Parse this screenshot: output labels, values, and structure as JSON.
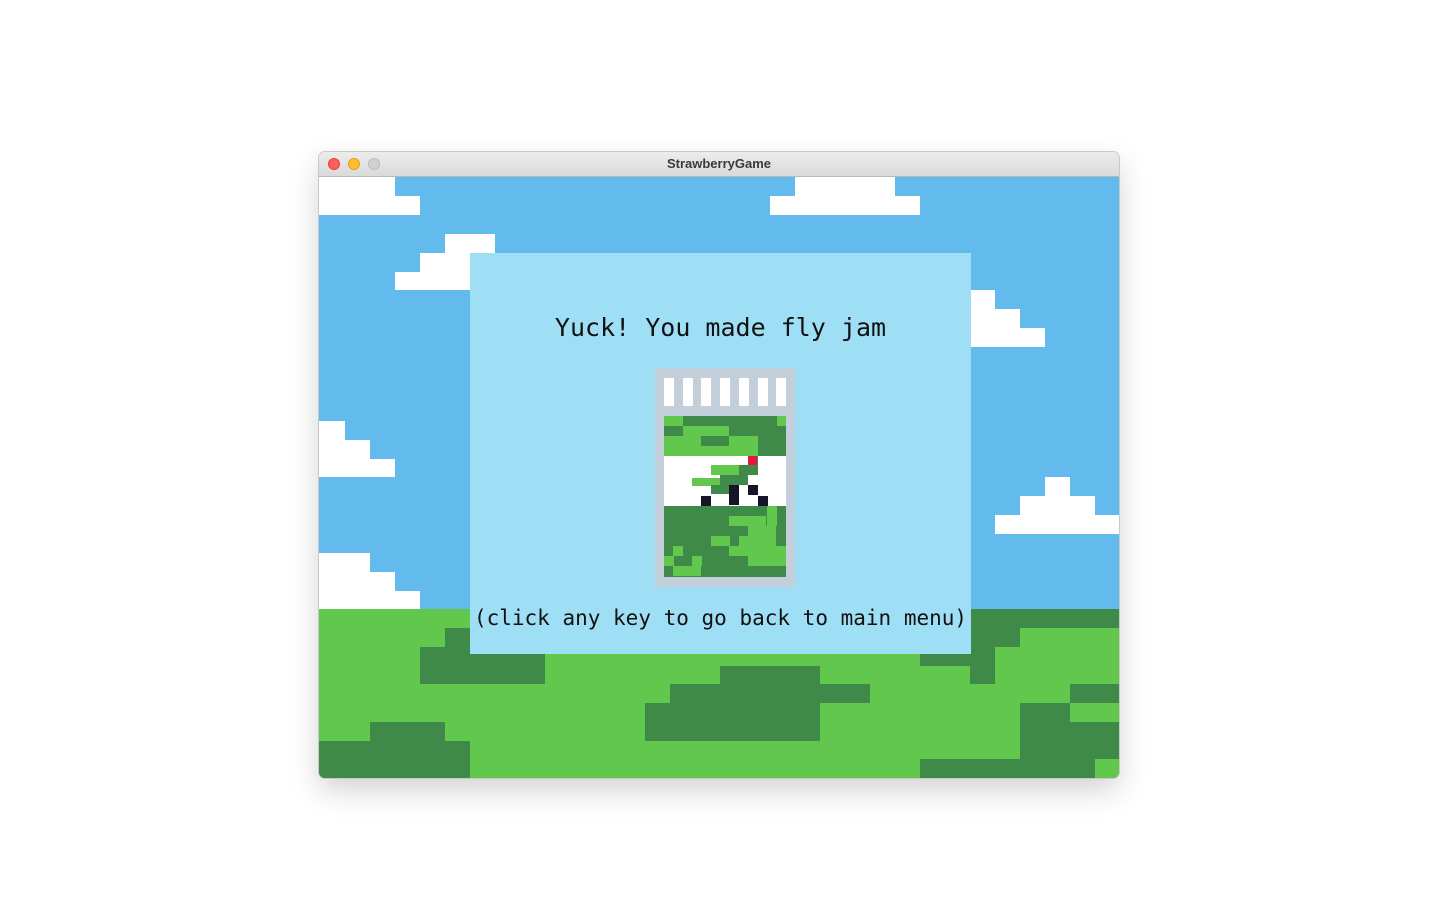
{
  "window": {
    "title": "StrawberryGame"
  },
  "dialog": {
    "message": "Yuck! You made fly jam",
    "hint": "(click any key to go back to main menu)"
  },
  "icons": {
    "jar": "fly-jam-jar-icon",
    "close": "close-icon",
    "minimize": "minimize-icon",
    "zoom": "zoom-icon"
  },
  "colors": {
    "sky": "#62bbec",
    "cloud": "#ffffff",
    "grass_light": "#62c74d",
    "grass_dark": "#3f8a48",
    "dialog": "#9edff6",
    "jar_lid": "#c3cfdb",
    "fly_eye": "#e8173f"
  }
}
